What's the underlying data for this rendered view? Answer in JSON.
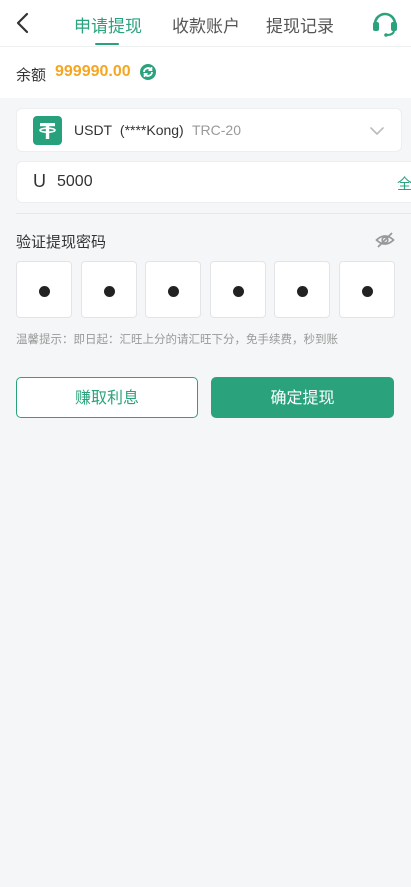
{
  "header": {
    "tabs": [
      {
        "label": "申请提现",
        "active": true
      },
      {
        "label": "收款账户",
        "active": false
      },
      {
        "label": "提现记录",
        "active": false
      }
    ],
    "back_icon": "chevron-left-icon",
    "support_icon": "headset-icon"
  },
  "balance": {
    "label": "余额",
    "amount": "999990.00",
    "refresh_icon": "refresh-icon"
  },
  "coin": {
    "name": "USDT",
    "account": "(****Kong)",
    "network": "TRC-20",
    "logo_glyph": "₮"
  },
  "amount": {
    "unit": "U",
    "value": "5000",
    "all_label": "全"
  },
  "password": {
    "title": "验证提现密码",
    "eye_icon": "eye-off-icon",
    "digits_filled": 6
  },
  "tip": "温馨提示：即日起：汇旺上分的请汇旺下分，免手续费，秒到账",
  "buttons": {
    "earn_label": "赚取利息",
    "confirm_label": "确定提现"
  },
  "colors": {
    "accent": "#2aa37c",
    "balance": "#f5a623",
    "usdt": "#26a17b"
  }
}
